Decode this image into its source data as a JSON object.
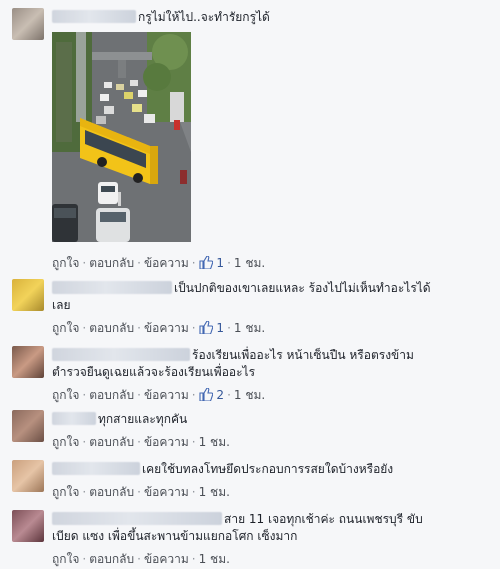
{
  "actions": {
    "like": "ถูกใจ",
    "reply": "ตอบกลับ",
    "message": "ข้อความ",
    "separator": "·"
  },
  "comments": [
    {
      "text": "กรูไม่ให้ไป..จะทำรัยกรูได้",
      "likes": "1",
      "time": "1 ชม."
    },
    {
      "text_line1": "เป็นปกติของเขาเลยแหละ ร้องไปไม่เห็นทำอะไรได้",
      "text_line2": "เลย",
      "likes": "1",
      "time": "1 ชม."
    },
    {
      "text_line1": "ร้องเรียนเพื่ออะไร หน้าเซ็นปืน หรือตรงข้าม",
      "text_line2": "ตำรวจยืนดูเฉยแล้วจะร้องเรียนเพื่ออะไร",
      "likes": "2",
      "time": "1 ชม."
    },
    {
      "text": "ทุกสายและทุกคัน",
      "time": "1 ชม."
    },
    {
      "text": "เคยใช้บทลงโทษยึดประกอบการรสยใดบ้างหรือยัง",
      "time": "1 ชม."
    },
    {
      "text_line1": "สาย 11 เจอทุกเช้าค่ะ ถนนเพชรบุรี ขับ",
      "text_line2": "เบียด แซง เพื่อขึ้นสะพานข้ามแยกอโศก เซ็งมาก",
      "time": "1 ชม."
    }
  ],
  "colors": {
    "background": "#f6f7f9",
    "text": "#1d2129",
    "meta": "#4b4f56",
    "link_blue": "#365899",
    "like_blue": "#4267b2",
    "bus_yellow": "#f2c318"
  }
}
